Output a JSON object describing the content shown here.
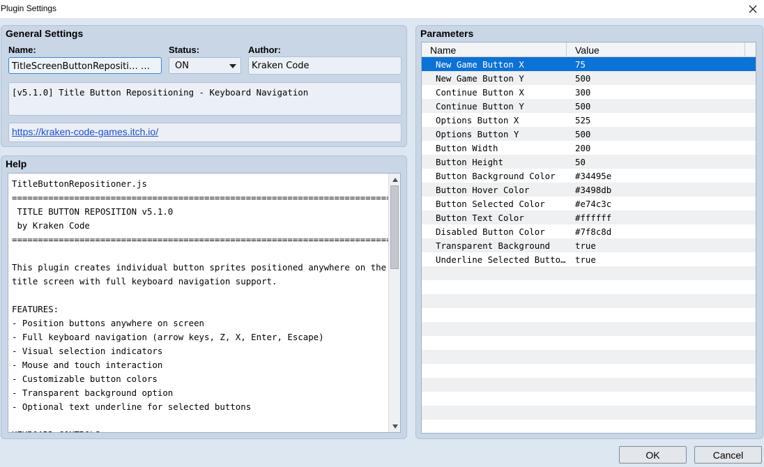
{
  "window": {
    "title": "Plugin Settings"
  },
  "general": {
    "heading": "General Settings",
    "name_label": "Name:",
    "name_value": "TitleScreenButtonRepositi… …",
    "status_label": "Status:",
    "status_value": "ON",
    "author_label": "Author:",
    "author_value": "Kraken Code",
    "description": "[v5.1.0] Title Button Repositioning - Keyboard Navigation",
    "url": "https://kraken-code-games.itch.io/"
  },
  "help": {
    "heading": "Help",
    "text": "TitleButtonRepositioner.js\n============================================================================\n TITLE BUTTON REPOSITION v5.1.0\n by Kraken Code\n============================================================================\n\nThis plugin creates individual button sprites positioned anywhere on the\ntitle screen with full keyboard navigation support.\n\nFEATURES:\n- Position buttons anywhere on screen\n- Full keyboard navigation (arrow keys, Z, X, Enter, Escape)\n- Visual selection indicators\n- Mouse and touch interaction\n- Customizable button colors\n- Transparent background option\n- Optional text underline for selected buttons\n\nKEYBOARD CONTROLS:"
  },
  "parameters": {
    "heading": "Parameters",
    "col_name": "Name",
    "col_value": "Value",
    "rows": [
      {
        "name": "New Game Button X",
        "value": "75"
      },
      {
        "name": "New Game Button Y",
        "value": "500"
      },
      {
        "name": "Continue Button X",
        "value": "300"
      },
      {
        "name": "Continue Button Y",
        "value": "500"
      },
      {
        "name": "Options Button X",
        "value": "525"
      },
      {
        "name": "Options Button Y",
        "value": "500"
      },
      {
        "name": "Button Width",
        "value": "200"
      },
      {
        "name": "Button Height",
        "value": "50"
      },
      {
        "name": "Button Background Color",
        "value": "#34495e"
      },
      {
        "name": "Button Hover Color",
        "value": "#3498db"
      },
      {
        "name": "Button Selected Color",
        "value": "#e74c3c"
      },
      {
        "name": "Button Text Color",
        "value": "#ffffff"
      },
      {
        "name": "Disabled Button Color",
        "value": "#7f8c8d"
      },
      {
        "name": "Transparent Background",
        "value": "true"
      },
      {
        "name": "Underline Selected Butto…",
        "value": "true"
      }
    ]
  },
  "buttons": {
    "ok": "OK",
    "cancel": "Cancel"
  },
  "colors": {
    "selection": "#0a72d8",
    "panel": "#c9d6e6",
    "link": "#1f4cd4"
  }
}
